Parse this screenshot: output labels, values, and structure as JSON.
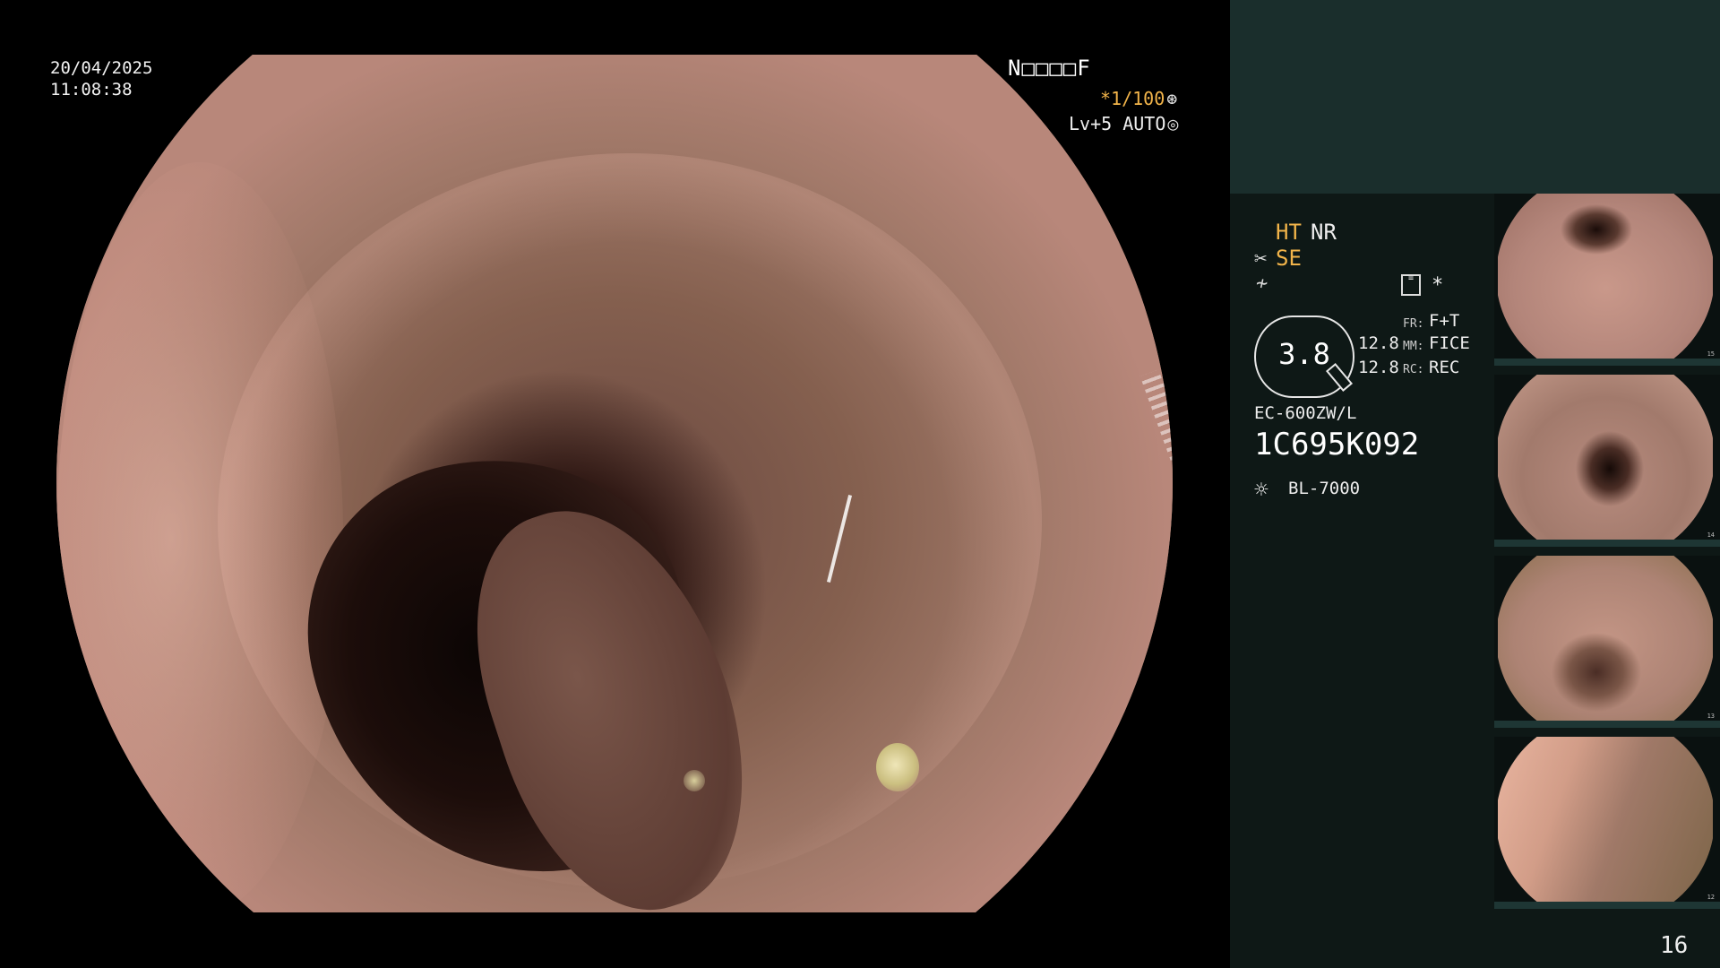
{
  "main": {
    "date": "20/04/2025",
    "time": "11:08:38",
    "patient_id": "N□□□□F",
    "shutter": "*1/100",
    "shutter_icon": "⊛",
    "level": "Lv+5 AUTO",
    "level_icon": "◎"
  },
  "panel": {
    "ht": "HT",
    "nr": "NR",
    "se": "SE",
    "scissor_icon": "✂",
    "wave_icon": "≁",
    "list_icon": "≡",
    "star": "*",
    "zoom": "3.8",
    "value_1": "12.8",
    "value_2": "12.8",
    "fr_label": "FR:",
    "fr_value": "F+T",
    "mm_label": "MM:",
    "mm_value": "FICE",
    "rc_label": "RC:",
    "rc_value": "REC",
    "scope_model": "EC-600ZW/L",
    "scope_serial": "1C695K092",
    "sun_icon": "☼",
    "light_source": "BL-7000",
    "page_number": "16"
  },
  "thumbnails": [
    {
      "number": "15"
    },
    {
      "number": "14"
    },
    {
      "number": "13"
    },
    {
      "number": "12"
    }
  ],
  "colors": {
    "accent_orange": "#f2b44a",
    "panel_bg": "#0e1816",
    "panel_top": "#1a2e2c"
  }
}
